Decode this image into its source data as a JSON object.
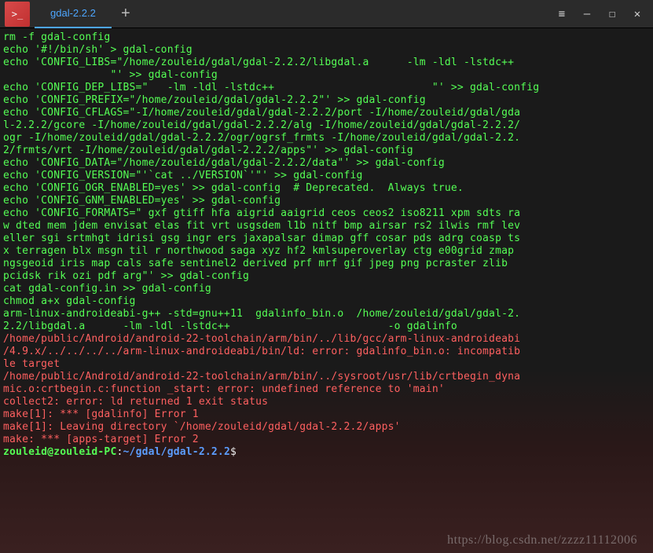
{
  "titlebar": {
    "tab_label": "gdal-2.2.2",
    "newtab_glyph": "+",
    "menu_glyph": "≡",
    "min_glyph": "—",
    "max_glyph": "☐",
    "close_glyph": "✕",
    "app_icon_glyph": ">_"
  },
  "terminal": {
    "lines": [
      {
        "c": "g",
        "t": "rm -f gdal-config"
      },
      {
        "c": "g",
        "t": "echo '#!/bin/sh' > gdal-config"
      },
      {
        "c": "g",
        "t": "echo 'CONFIG_LIBS=\"/home/zouleid/gdal/gdal-2.2.2/libgdal.a      -lm -ldl -lstdc++"
      },
      {
        "c": "g",
        "t": "                 \"' >> gdal-config"
      },
      {
        "c": "g",
        "t": "echo 'CONFIG_DEP_LIBS=\"   -lm -ldl -lstdc++                         \"' >> gdal-config"
      },
      {
        "c": "g",
        "t": "echo 'CONFIG_PREFIX=\"/home/zouleid/gdal/gdal-2.2.2\"' >> gdal-config"
      },
      {
        "c": "g",
        "t": "echo 'CONFIG_CFLAGS=\"-I/home/zouleid/gdal/gdal-2.2.2/port -I/home/zouleid/gdal/gda"
      },
      {
        "c": "g",
        "t": "l-2.2.2/gcore -I/home/zouleid/gdal/gdal-2.2.2/alg -I/home/zouleid/gdal/gdal-2.2.2/"
      },
      {
        "c": "g",
        "t": "ogr -I/home/zouleid/gdal/gdal-2.2.2/ogr/ogrsf_frmts -I/home/zouleid/gdal/gdal-2.2."
      },
      {
        "c": "g",
        "t": "2/frmts/vrt -I/home/zouleid/gdal/gdal-2.2.2/apps\"' >> gdal-config"
      },
      {
        "c": "g",
        "t": "echo 'CONFIG_DATA=\"/home/zouleid/gdal/gdal-2.2.2/data\"' >> gdal-config"
      },
      {
        "c": "g",
        "t": "echo 'CONFIG_VERSION=\"'`cat ../VERSION`'\"' >> gdal-config"
      },
      {
        "c": "g",
        "t": "echo 'CONFIG_OGR_ENABLED=yes' >> gdal-config  # Deprecated.  Always true."
      },
      {
        "c": "g",
        "t": "echo 'CONFIG_GNM_ENABLED=yes' >> gdal-config"
      },
      {
        "c": "g",
        "t": "echo 'CONFIG_FORMATS=\" gxf gtiff hfa aigrid aaigrid ceos ceos2 iso8211 xpm sdts ra"
      },
      {
        "c": "g",
        "t": "w dted mem jdem envisat elas fit vrt usgsdem l1b nitf bmp airsar rs2 ilwis rmf lev"
      },
      {
        "c": "g",
        "t": "eller sgi srtmhgt idrisi gsg ingr ers jaxapalsar dimap gff cosar pds adrg coasp ts"
      },
      {
        "c": "g",
        "t": "x terragen blx msgn til r northwood saga xyz hf2 kmlsuperoverlay ctg e00grid zmap"
      },
      {
        "c": "g",
        "t": "ngsgeoid iris map cals safe sentinel2 derived prf mrf gif jpeg png pcraster zlib"
      },
      {
        "c": "g",
        "t": "pcidsk rik ozi pdf arg\"' >> gdal-config"
      },
      {
        "c": "g",
        "t": "cat gdal-config.in >> gdal-config"
      },
      {
        "c": "g",
        "t": "chmod a+x gdal-config"
      },
      {
        "c": "g",
        "t": "arm-linux-androideabi-g++ -std=gnu++11  gdalinfo_bin.o  /home/zouleid/gdal/gdal-2."
      },
      {
        "c": "g",
        "t": "2.2/libgdal.a      -lm -ldl -lstdc++                         -o gdalinfo"
      },
      {
        "c": "r",
        "t": "/home/public/Android/android-22-toolchain/arm/bin/../lib/gcc/arm-linux-androideabi"
      },
      {
        "c": "r",
        "t": "/4.9.x/../../../../arm-linux-androideabi/bin/ld: error: gdalinfo_bin.o: incompatib"
      },
      {
        "c": "r",
        "t": "le target"
      },
      {
        "c": "r",
        "t": "/home/public/Android/android-22-toolchain/arm/bin/../sysroot/usr/lib/crtbegin_dyna"
      },
      {
        "c": "r",
        "t": "mic.o:crtbegin.c:function _start: error: undefined reference to 'main'"
      },
      {
        "c": "r",
        "t": "collect2: error: ld returned 1 exit status"
      },
      {
        "c": "r",
        "t": "make[1]: *** [gdalinfo] Error 1"
      },
      {
        "c": "r",
        "t": "make[1]: Leaving directory `/home/zouleid/gdal/gdal-2.2.2/apps'"
      },
      {
        "c": "r",
        "t": "make: *** [apps-target] Error 2"
      }
    ],
    "prompt": {
      "user_host": "zouleid@zouleid-PC",
      "colon": ":",
      "path": "~/gdal/gdal-2.2.2",
      "dollar": "$"
    }
  },
  "watermark": "https://blog.csdn.net/zzzz11112006"
}
